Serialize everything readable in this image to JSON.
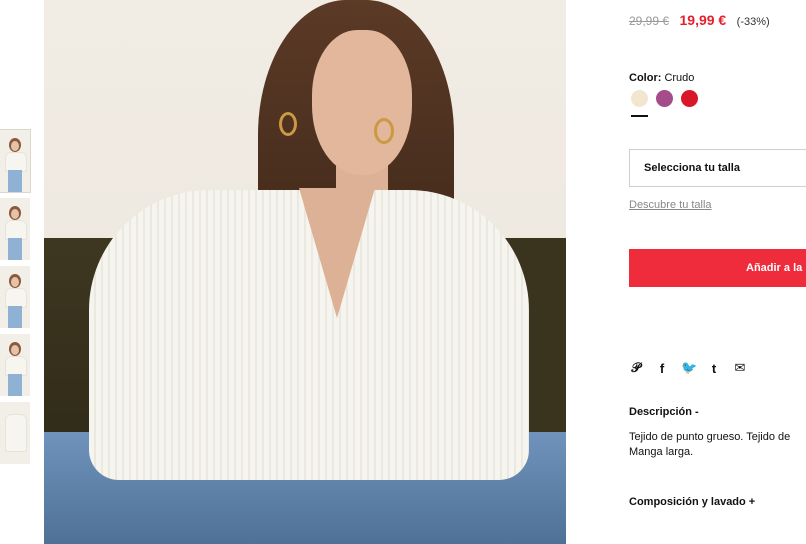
{
  "product": {
    "old_price": "29,99 €",
    "new_price": "19,99 €",
    "discount": "(-33%)",
    "color_label": "Color:",
    "color_value": "Crudo",
    "swatches": [
      {
        "name": "crudo",
        "color": "#f3e6cf"
      },
      {
        "name": "mauve",
        "color": "#a44d8a"
      },
      {
        "name": "red",
        "color": "#d81828"
      }
    ],
    "size_placeholder": "Selecciona tu talla",
    "size_guide": "Descubre tu talla",
    "add_button": "Añadir a la",
    "share_icons": [
      "pinterest-icon",
      "facebook-icon",
      "twitter-icon",
      "tumblr-icon",
      "email-icon"
    ],
    "description_title": "Descripción -",
    "description_line1": "Tejido de punto grueso. Tejido de",
    "description_line2": "Manga larga.",
    "composition_title": "Composición y lavado +"
  },
  "colors": {
    "accent_red": "#ee2c3c",
    "price_red": "#e5202e"
  }
}
